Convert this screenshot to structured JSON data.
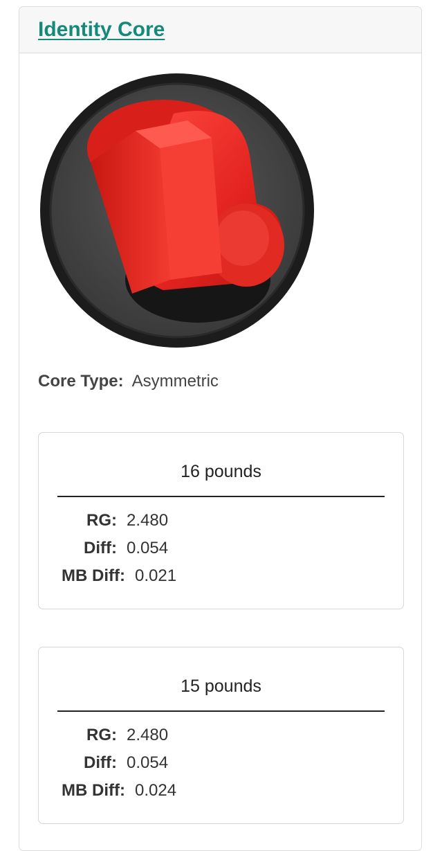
{
  "card": {
    "title": "Identity Core"
  },
  "core_image": {
    "icon": "bowling-ball-core-image",
    "colors": {
      "ring": "#1c1c1c",
      "background": "#4a4a4a",
      "core": "#e3231f",
      "core_highlight": "#ff4a40",
      "base": "#161616"
    }
  },
  "core_type": {
    "label": "Core Type:",
    "value": "Asymmetric"
  },
  "weights": [
    {
      "title": "16 pounds",
      "specs": {
        "rg_label": "RG:",
        "rg_value": "2.480",
        "diff_label": "Diff:",
        "diff_value": "0.054",
        "mb_label": "MB Diff:",
        "mb_value": "0.021"
      }
    },
    {
      "title": "15 pounds",
      "specs": {
        "rg_label": "RG:",
        "rg_value": "2.480",
        "diff_label": "Diff:",
        "diff_value": "0.054",
        "mb_label": "MB Diff:",
        "mb_value": "0.024"
      }
    }
  ]
}
